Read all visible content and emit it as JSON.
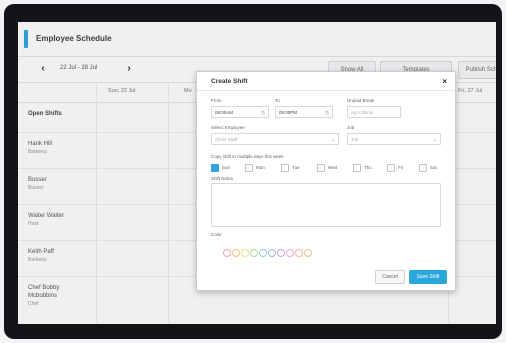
{
  "app": {
    "title": "Employee Schedule"
  },
  "toolbar": {
    "prev": "‹",
    "date_range": "22 Jul - 28 Jul",
    "next": "›",
    "button1": "Show All",
    "button2": "Templates",
    "publish": "Publish Sche"
  },
  "grid": {
    "columns": [
      "Sun, 22 Jul",
      "Mo",
      "Fri, 27 Jul"
    ],
    "rows": [
      {
        "name": "Open Shifts",
        "role": ""
      },
      {
        "name": "Hank Hill",
        "role": "Barkeep"
      },
      {
        "name": "Busser",
        "role": "Busser"
      },
      {
        "name": "Waiter Waiter",
        "role": "Host"
      },
      {
        "name": "Keith Paff",
        "role": "Barkeep"
      },
      {
        "name": "Chef Bobby Mcbobbins",
        "role": "Chef"
      }
    ]
  },
  "modal": {
    "title": "Create Shift",
    "close": "×",
    "from_label": "From",
    "to_label": "To",
    "unpaid_label": "Unpaid Break",
    "from_value": "08:00AM",
    "to_value": "05:00PM",
    "unpaid_placeholder": "eg 0.30min",
    "employee_label": "Select Employee",
    "employee_placeholder": "Client Staff",
    "job_label": "Job",
    "job_placeholder": "Job",
    "copy_label": "Copy shift to multiple days this week",
    "days": [
      "Sun",
      "Mon",
      "Tue",
      "Wed",
      "Thu",
      "Fri",
      "Sat"
    ],
    "checked_day": "Sun",
    "notes_label": "Shift Notes",
    "color_label": "Color",
    "colors": [
      "#f0a5a5",
      "#f5c27a",
      "#f3e07a",
      "#a9dca0",
      "#8fd0e8",
      "#a7b7ee",
      "#c7a7ea",
      "#f0a8d4",
      "#f3b79a",
      "#e8c58d"
    ],
    "cancel": "Cancel",
    "save": "Save Shift"
  },
  "colors": {
    "accent": "#2aa7df",
    "frame": "#121418"
  }
}
